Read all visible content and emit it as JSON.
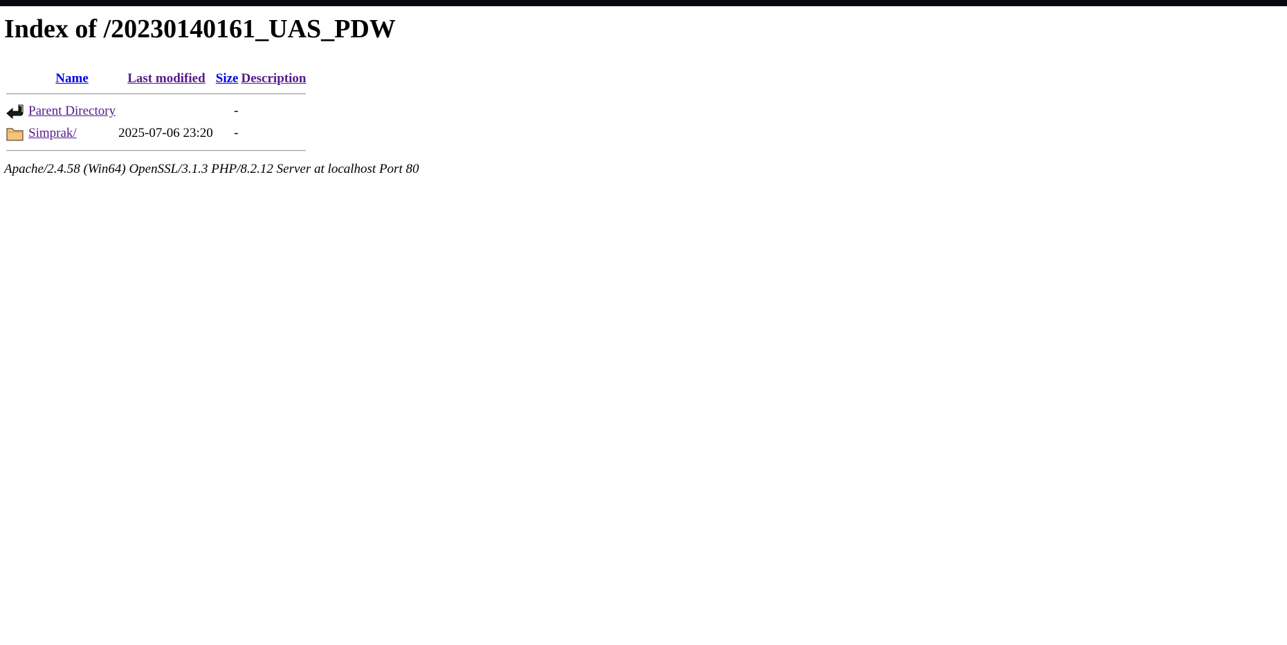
{
  "page": {
    "heading": "Index of /20230140161_UAS_PDW"
  },
  "table": {
    "headers": {
      "name": "Name",
      "last_modified": "Last modified",
      "size": "Size",
      "description": "Description"
    },
    "rows": [
      {
        "icon": "back-arrow-icon",
        "name": "Parent Directory",
        "last_modified": "",
        "size": "-",
        "description": ""
      },
      {
        "icon": "folder-icon",
        "name": "Simprak/",
        "last_modified": "2025-07-06 23:20",
        "size": "-",
        "description": ""
      }
    ]
  },
  "footer": {
    "server_signature": "Apache/2.4.58 (Win64) OpenSSL/3.1.3 PHP/8.2.12 Server at localhost Port 80"
  },
  "colors": {
    "topbar": "#0b0711",
    "link_visited": "#551a8b",
    "link_unvisited": "#0000ee",
    "folder_fill": "#f6c27a"
  }
}
